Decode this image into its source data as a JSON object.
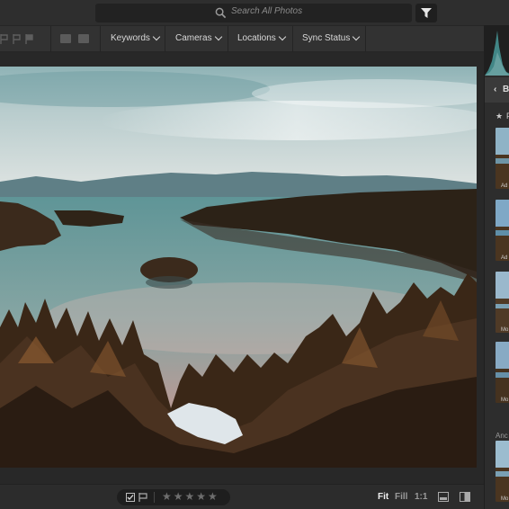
{
  "search": {
    "placeholder": "Search All Photos",
    "icon": "search-icon"
  },
  "filter_button": {
    "icon": "funnel-icon"
  },
  "filter_bar": {
    "menus": [
      {
        "label": "Keywords"
      },
      {
        "label": "Cameras"
      },
      {
        "label": "Locations"
      },
      {
        "label": "Sync Status"
      }
    ]
  },
  "bottom_bar": {
    "stars": "★★★★★",
    "zoom": {
      "fit": "Fit",
      "fill": "Fill",
      "one_to_one": "1:1"
    }
  },
  "right_panel": {
    "back_label": "B",
    "back_icon": "chevron-left-icon",
    "section_star": "★",
    "section_letter": "F",
    "thumb_captions": [
      "Ad",
      "Ad",
      "Mo",
      "Mo",
      "Mo"
    ],
    "sub_label": "Anc"
  },
  "colors": {
    "accent_bg": "#2b2b2b",
    "panel": "#323232",
    "text": "#d6d6d6"
  }
}
